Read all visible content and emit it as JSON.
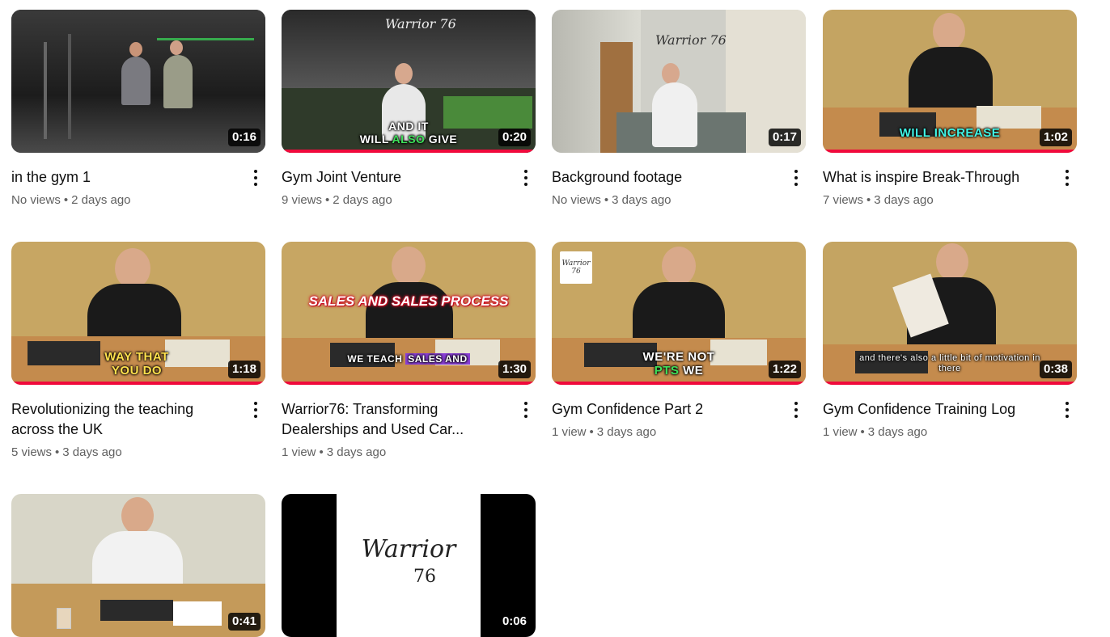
{
  "videos": [
    {
      "title": "in the gym 1",
      "views": "No views",
      "age": "2 days ago",
      "duration": "0:16",
      "caption": "",
      "watched": false
    },
    {
      "title": "Gym Joint Venture",
      "views": "9 views",
      "age": "2 days ago",
      "duration": "0:20",
      "caption_line1": "AND IT",
      "caption_line2_pre": "WILL ",
      "caption_line2_hl": "ALSO",
      "caption_line2_post": " GIVE",
      "logo": "Warrior",
      "logo_num": "76",
      "watched": true
    },
    {
      "title": "Background footage",
      "views": "No views",
      "age": "3 days ago",
      "duration": "0:17",
      "logo": "Warrior",
      "logo_num": "76",
      "watched": false
    },
    {
      "title": "What is inspire Break-Through",
      "views": "7 views",
      "age": "3 days ago",
      "duration": "1:02",
      "caption": "WILL INCREASE",
      "watched": true
    },
    {
      "title": "Revolutionizing the teaching across the UK",
      "views": "5 views",
      "age": "3 days ago",
      "duration": "1:18",
      "caption_line1": "WAY THAT",
      "caption_line2": "YOU DO",
      "watched": true
    },
    {
      "title": "Warrior76: Transforming Dealerships and Used Car...",
      "views": "1 view",
      "age": "3 days ago",
      "duration": "1:30",
      "banner": "SALES AND SALES PROCESS",
      "caption_pre": "WE TEACH ",
      "caption_hl": "SALES AND",
      "watched": true
    },
    {
      "title": "Gym Confidence Part 2",
      "views": "1 view",
      "age": "3 days ago",
      "duration": "1:22",
      "caption_line1": "WE'RE NOT",
      "caption_line2_hl": "PTS",
      "caption_line2_post": " WE",
      "logo": "Warrior",
      "logo_num": "76",
      "watched": true
    },
    {
      "title": "Gym Confidence Training Log",
      "views": "1 view",
      "age": "3 days ago",
      "duration": "0:38",
      "caption_line1": "and there's also a little bit of motivation in",
      "caption_line2": "there",
      "watched": true
    },
    {
      "title": "",
      "views": "",
      "age": "",
      "duration": "0:41",
      "watched": false
    },
    {
      "title": "",
      "views": "",
      "age": "",
      "duration": "0:06",
      "logo": "Warrior",
      "logo_num": "76",
      "watched": false
    }
  ],
  "meta_separator": "•",
  "colors": {
    "progress": "#f00a3c",
    "title": "#0f0f0f",
    "meta": "#606060"
  }
}
